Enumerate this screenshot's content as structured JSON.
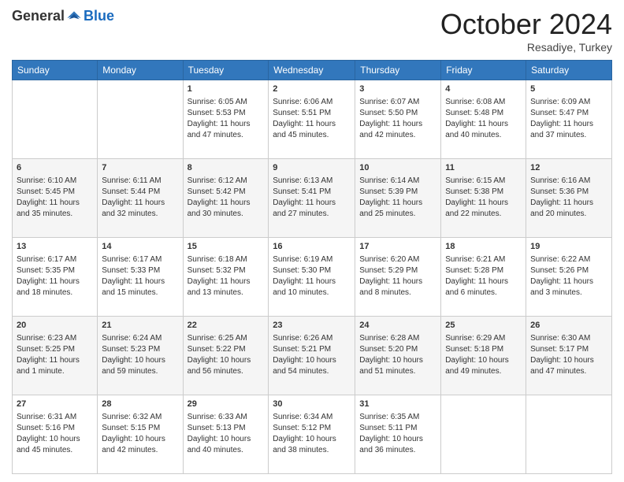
{
  "header": {
    "logo": {
      "general": "General",
      "blue": "Blue"
    },
    "title": "October 2024",
    "subtitle": "Resadiye, Turkey"
  },
  "weekdays": [
    "Sunday",
    "Monday",
    "Tuesday",
    "Wednesday",
    "Thursday",
    "Friday",
    "Saturday"
  ],
  "weeks": [
    [
      {
        "day": "",
        "sunrise": "",
        "sunset": "",
        "daylight": ""
      },
      {
        "day": "",
        "sunrise": "",
        "sunset": "",
        "daylight": ""
      },
      {
        "day": "1",
        "sunrise": "Sunrise: 6:05 AM",
        "sunset": "Sunset: 5:53 PM",
        "daylight": "Daylight: 11 hours and 47 minutes."
      },
      {
        "day": "2",
        "sunrise": "Sunrise: 6:06 AM",
        "sunset": "Sunset: 5:51 PM",
        "daylight": "Daylight: 11 hours and 45 minutes."
      },
      {
        "day": "3",
        "sunrise": "Sunrise: 6:07 AM",
        "sunset": "Sunset: 5:50 PM",
        "daylight": "Daylight: 11 hours and 42 minutes."
      },
      {
        "day": "4",
        "sunrise": "Sunrise: 6:08 AM",
        "sunset": "Sunset: 5:48 PM",
        "daylight": "Daylight: 11 hours and 40 minutes."
      },
      {
        "day": "5",
        "sunrise": "Sunrise: 6:09 AM",
        "sunset": "Sunset: 5:47 PM",
        "daylight": "Daylight: 11 hours and 37 minutes."
      }
    ],
    [
      {
        "day": "6",
        "sunrise": "Sunrise: 6:10 AM",
        "sunset": "Sunset: 5:45 PM",
        "daylight": "Daylight: 11 hours and 35 minutes."
      },
      {
        "day": "7",
        "sunrise": "Sunrise: 6:11 AM",
        "sunset": "Sunset: 5:44 PM",
        "daylight": "Daylight: 11 hours and 32 minutes."
      },
      {
        "day": "8",
        "sunrise": "Sunrise: 6:12 AM",
        "sunset": "Sunset: 5:42 PM",
        "daylight": "Daylight: 11 hours and 30 minutes."
      },
      {
        "day": "9",
        "sunrise": "Sunrise: 6:13 AM",
        "sunset": "Sunset: 5:41 PM",
        "daylight": "Daylight: 11 hours and 27 minutes."
      },
      {
        "day": "10",
        "sunrise": "Sunrise: 6:14 AM",
        "sunset": "Sunset: 5:39 PM",
        "daylight": "Daylight: 11 hours and 25 minutes."
      },
      {
        "day": "11",
        "sunrise": "Sunrise: 6:15 AM",
        "sunset": "Sunset: 5:38 PM",
        "daylight": "Daylight: 11 hours and 22 minutes."
      },
      {
        "day": "12",
        "sunrise": "Sunrise: 6:16 AM",
        "sunset": "Sunset: 5:36 PM",
        "daylight": "Daylight: 11 hours and 20 minutes."
      }
    ],
    [
      {
        "day": "13",
        "sunrise": "Sunrise: 6:17 AM",
        "sunset": "Sunset: 5:35 PM",
        "daylight": "Daylight: 11 hours and 18 minutes."
      },
      {
        "day": "14",
        "sunrise": "Sunrise: 6:17 AM",
        "sunset": "Sunset: 5:33 PM",
        "daylight": "Daylight: 11 hours and 15 minutes."
      },
      {
        "day": "15",
        "sunrise": "Sunrise: 6:18 AM",
        "sunset": "Sunset: 5:32 PM",
        "daylight": "Daylight: 11 hours and 13 minutes."
      },
      {
        "day": "16",
        "sunrise": "Sunrise: 6:19 AM",
        "sunset": "Sunset: 5:30 PM",
        "daylight": "Daylight: 11 hours and 10 minutes."
      },
      {
        "day": "17",
        "sunrise": "Sunrise: 6:20 AM",
        "sunset": "Sunset: 5:29 PM",
        "daylight": "Daylight: 11 hours and 8 minutes."
      },
      {
        "day": "18",
        "sunrise": "Sunrise: 6:21 AM",
        "sunset": "Sunset: 5:28 PM",
        "daylight": "Daylight: 11 hours and 6 minutes."
      },
      {
        "day": "19",
        "sunrise": "Sunrise: 6:22 AM",
        "sunset": "Sunset: 5:26 PM",
        "daylight": "Daylight: 11 hours and 3 minutes."
      }
    ],
    [
      {
        "day": "20",
        "sunrise": "Sunrise: 6:23 AM",
        "sunset": "Sunset: 5:25 PM",
        "daylight": "Daylight: 11 hours and 1 minute."
      },
      {
        "day": "21",
        "sunrise": "Sunrise: 6:24 AM",
        "sunset": "Sunset: 5:23 PM",
        "daylight": "Daylight: 10 hours and 59 minutes."
      },
      {
        "day": "22",
        "sunrise": "Sunrise: 6:25 AM",
        "sunset": "Sunset: 5:22 PM",
        "daylight": "Daylight: 10 hours and 56 minutes."
      },
      {
        "day": "23",
        "sunrise": "Sunrise: 6:26 AM",
        "sunset": "Sunset: 5:21 PM",
        "daylight": "Daylight: 10 hours and 54 minutes."
      },
      {
        "day": "24",
        "sunrise": "Sunrise: 6:28 AM",
        "sunset": "Sunset: 5:20 PM",
        "daylight": "Daylight: 10 hours and 51 minutes."
      },
      {
        "day": "25",
        "sunrise": "Sunrise: 6:29 AM",
        "sunset": "Sunset: 5:18 PM",
        "daylight": "Daylight: 10 hours and 49 minutes."
      },
      {
        "day": "26",
        "sunrise": "Sunrise: 6:30 AM",
        "sunset": "Sunset: 5:17 PM",
        "daylight": "Daylight: 10 hours and 47 minutes."
      }
    ],
    [
      {
        "day": "27",
        "sunrise": "Sunrise: 6:31 AM",
        "sunset": "Sunset: 5:16 PM",
        "daylight": "Daylight: 10 hours and 45 minutes."
      },
      {
        "day": "28",
        "sunrise": "Sunrise: 6:32 AM",
        "sunset": "Sunset: 5:15 PM",
        "daylight": "Daylight: 10 hours and 42 minutes."
      },
      {
        "day": "29",
        "sunrise": "Sunrise: 6:33 AM",
        "sunset": "Sunset: 5:13 PM",
        "daylight": "Daylight: 10 hours and 40 minutes."
      },
      {
        "day": "30",
        "sunrise": "Sunrise: 6:34 AM",
        "sunset": "Sunset: 5:12 PM",
        "daylight": "Daylight: 10 hours and 38 minutes."
      },
      {
        "day": "31",
        "sunrise": "Sunrise: 6:35 AM",
        "sunset": "Sunset: 5:11 PM",
        "daylight": "Daylight: 10 hours and 36 minutes."
      },
      {
        "day": "",
        "sunrise": "",
        "sunset": "",
        "daylight": ""
      },
      {
        "day": "",
        "sunrise": "",
        "sunset": "",
        "daylight": ""
      }
    ]
  ]
}
